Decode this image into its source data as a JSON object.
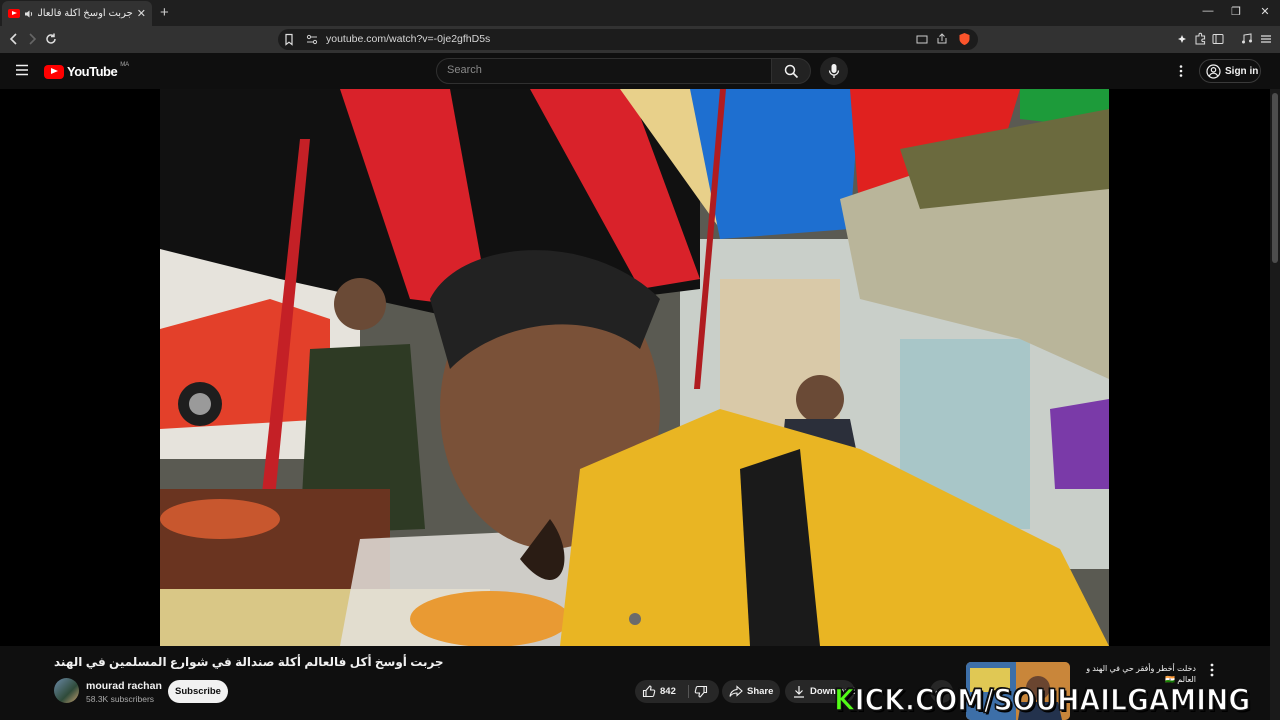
{
  "browser": {
    "tab_title": "جربت أوسخ أكلة فالعالم ...",
    "url": "youtube.com/watch?v=-0je2gfhD5s"
  },
  "youtube": {
    "logo_text": "YouTube",
    "logo_region": "MA",
    "search_placeholder": "Search",
    "sign_in_label": "Sign in"
  },
  "video": {
    "title": "جربت أوسخ أكل فالعالم أكلة صندالة في شوارع المسلمين في الهند",
    "channel_name": "mourad rachan",
    "subscribers": "58.3K subscribers",
    "subscribe_label": "Subscribe",
    "likes": "842",
    "share_label": "Share",
    "download_label": "Download"
  },
  "recommended": {
    "title": "دخلت أخطر وأفقر حي في الهند و العالم 🇮🇳"
  },
  "overlay": {
    "kick_first": "K",
    "kick_rest": "ICK.COM/SOUHAILGAMING"
  },
  "colors": {
    "youtube_red": "#ff0000",
    "kick_green": "#53fc18",
    "background": "#0f0f0f"
  }
}
